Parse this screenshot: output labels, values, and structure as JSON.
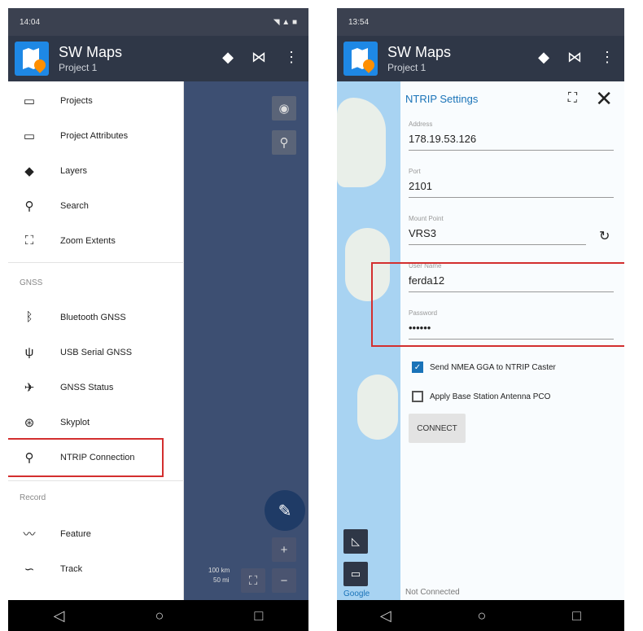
{
  "left": {
    "status_time": "14:04",
    "app_title": "SW Maps",
    "project_name": "Project 1",
    "menu": [
      {
        "label": "Projects",
        "icon": "folder-icon"
      },
      {
        "label": "Project Attributes",
        "icon": "folder-icon"
      },
      {
        "label": "Layers",
        "icon": "layers-icon"
      },
      {
        "label": "Search",
        "icon": "search-icon"
      },
      {
        "label": "Zoom Extents",
        "icon": "zoom-extents-icon"
      }
    ],
    "gnss_header": "GNSS",
    "gnss_menu": [
      {
        "label": "Bluetooth GNSS",
        "icon": "bluetooth-icon"
      },
      {
        "label": "USB Serial GNSS",
        "icon": "usb-icon"
      },
      {
        "label": "GNSS Status",
        "icon": "satellite-icon"
      },
      {
        "label": "Skyplot",
        "icon": "skyplot-icon"
      },
      {
        "label": "NTRIP Connection",
        "icon": "ntrip-icon"
      }
    ],
    "record_header": "Record",
    "record_menu": [
      {
        "label": "Feature",
        "icon": "feature-icon"
      },
      {
        "label": "Track",
        "icon": "track-icon"
      }
    ],
    "scale_km": "100 km",
    "scale_mi": "50 mi"
  },
  "right": {
    "status_time": "13:54",
    "app_title": "SW Maps",
    "project_name": "Project 1",
    "panel_title": "NTRIP Settings",
    "fields": {
      "address": {
        "label": "Address",
        "value": "178.19.53.126"
      },
      "port": {
        "label": "Port",
        "value": "2101"
      },
      "mount_point": {
        "label": "Mount Point",
        "value": "VRS3"
      },
      "user_name": {
        "label": "User Name",
        "value": "ferda12"
      },
      "password": {
        "label": "Password",
        "value": "••••••"
      }
    },
    "send_nmea_label": "Send NMEA GGA to NTRIP Caster",
    "apply_pco_label": "Apply Base Station Antenna PCO",
    "connect_label": "CONNECT",
    "status": "Not Connected",
    "google": "Google"
  },
  "colors": {
    "highlight": "#d32f2f",
    "appbar": "#2f3747",
    "accent": "#1a73b8"
  }
}
